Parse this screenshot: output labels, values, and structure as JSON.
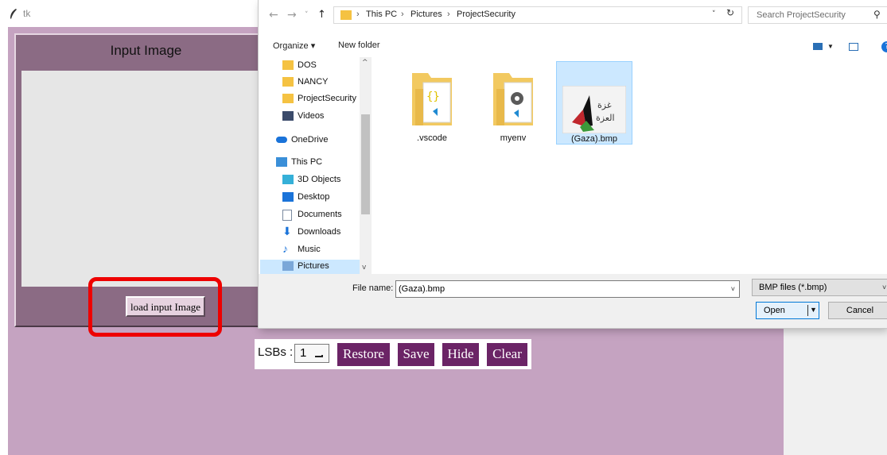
{
  "window": {
    "title": "tk"
  },
  "input_panel": {
    "title": "Input Image",
    "load_button": "load input Image"
  },
  "toolbar": {
    "lsb_label": "LSBs :",
    "lsb_value": "1",
    "restore": "Restore",
    "save": "Save",
    "hide": "Hide",
    "clear": "Clear"
  },
  "dialog": {
    "breadcrumb": [
      "This PC",
      "Pictures",
      "ProjectSecurity"
    ],
    "search_placeholder": "Search ProjectSecurity",
    "organize": "Organize ▾",
    "new_folder": "New folder",
    "nav_items": [
      {
        "label": "DOS",
        "icon": "folder-icon"
      },
      {
        "label": "NANCY",
        "icon": "folder-icon"
      },
      {
        "label": "ProjectSecurity",
        "icon": "folder-icon"
      },
      {
        "label": "Videos",
        "icon": "videos-icon"
      },
      {
        "label": "OneDrive",
        "icon": "cloud-icon"
      },
      {
        "label": "This PC",
        "icon": "computer-icon"
      },
      {
        "label": "3D Objects",
        "icon": "cube-icon"
      },
      {
        "label": "Desktop",
        "icon": "desktop-icon"
      },
      {
        "label": "Documents",
        "icon": "documents-icon"
      },
      {
        "label": "Downloads",
        "icon": "download-icon"
      },
      {
        "label": "Music",
        "icon": "music-icon"
      },
      {
        "label": "Pictures",
        "icon": "pictures-icon"
      }
    ],
    "files": [
      {
        "name": ".vscode",
        "icon": "vscode-folder-icon"
      },
      {
        "name": "myenv",
        "icon": "settings-folder-icon"
      },
      {
        "name": "(Gaza).bmp",
        "icon": "bmp-thumbnail"
      }
    ],
    "file_name_label": "File name:",
    "file_name_value": "(Gaza).bmp",
    "file_type": "BMP files (*.bmp)",
    "open": "Open",
    "cancel": "Cancel"
  },
  "colors": {
    "tk_background": "#c5a3c1",
    "panel": "#8b6b84",
    "toolbar_button": "#6b2466",
    "highlight_box": "#ee0000",
    "selection": "#cce8ff"
  }
}
